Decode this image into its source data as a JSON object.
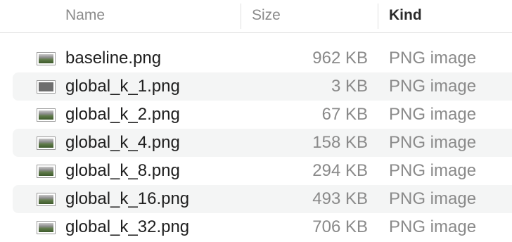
{
  "columns": {
    "name": "Name",
    "size": "Size",
    "kind": "Kind"
  },
  "files": [
    {
      "name": "baseline.png",
      "size": "962 KB",
      "kind": "PNG image",
      "icon": "image-thumbnail-icon"
    },
    {
      "name": "global_k_1.png",
      "size": "3 KB",
      "kind": "PNG image",
      "icon": "image-thumbnail-icon"
    },
    {
      "name": "global_k_2.png",
      "size": "67 KB",
      "kind": "PNG image",
      "icon": "image-thumbnail-icon"
    },
    {
      "name": "global_k_4.png",
      "size": "158 KB",
      "kind": "PNG image",
      "icon": "image-thumbnail-icon"
    },
    {
      "name": "global_k_8.png",
      "size": "294 KB",
      "kind": "PNG image",
      "icon": "image-thumbnail-icon"
    },
    {
      "name": "global_k_16.png",
      "size": "493 KB",
      "kind": "PNG image",
      "icon": "image-thumbnail-icon"
    },
    {
      "name": "global_k_32.png",
      "size": "706 KB",
      "kind": "PNG image",
      "icon": "image-thumbnail-icon"
    }
  ]
}
